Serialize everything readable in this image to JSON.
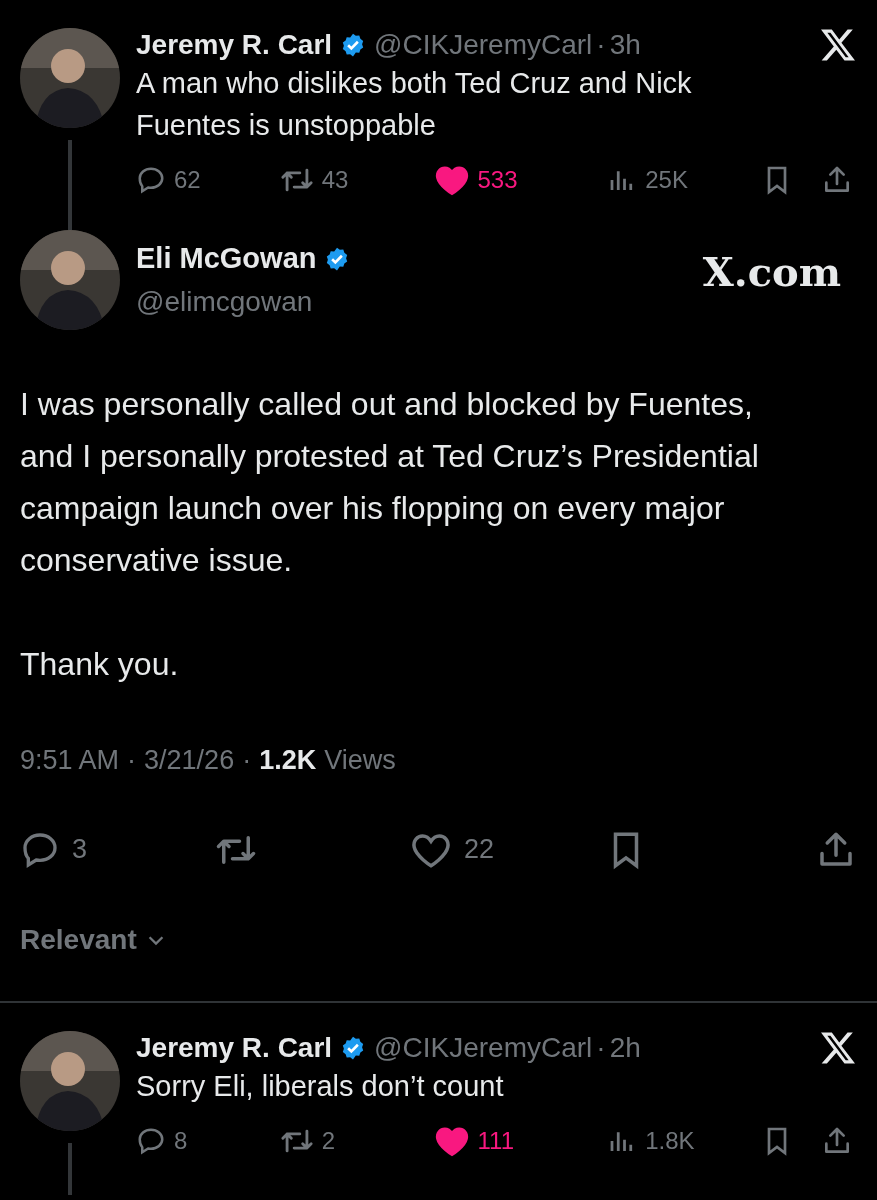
{
  "replies_above": [
    {
      "name": "Jeremy R. Carl",
      "verified": true,
      "handle": "@CIKJeremyCarl",
      "dot": "·",
      "time": "3h",
      "text": "A man who dislikes both Ted Cruz and Nick Fuentes is unstoppable",
      "thread_below": true,
      "stats": {
        "replies": "62",
        "reposts": "43",
        "likes": "533",
        "liked": true,
        "views": "25K"
      }
    }
  ],
  "main": {
    "name": "Eli McGowan",
    "verified": true,
    "handle": "@elimcgowan",
    "brand": "X.com",
    "paragraphs": [
      "I was personally called out and blocked by Fuentes, and I personally protested at Ted Cruz’s Presidential campaign launch over his flopping on every major conservative issue.",
      "Thank you."
    ],
    "time": "9:51 AM",
    "dot1": "·",
    "date": "3/21/26",
    "dot2": "·",
    "views_count": "1.2K",
    "views_label": "Views",
    "stats": {
      "replies": "3",
      "likes": "22",
      "liked": false
    }
  },
  "sort": {
    "label": "Relevant"
  },
  "replies": [
    {
      "name": "Jeremy R. Carl",
      "verified": true,
      "handle": "@CIKJeremyCarl",
      "dot": "·",
      "time": "2h",
      "text": "Sorry Eli, liberals don’t count",
      "thread_below": true,
      "stats": {
        "replies": "8",
        "reposts": "2",
        "likes": "111",
        "liked": true,
        "views": "1.8K"
      }
    }
  ]
}
